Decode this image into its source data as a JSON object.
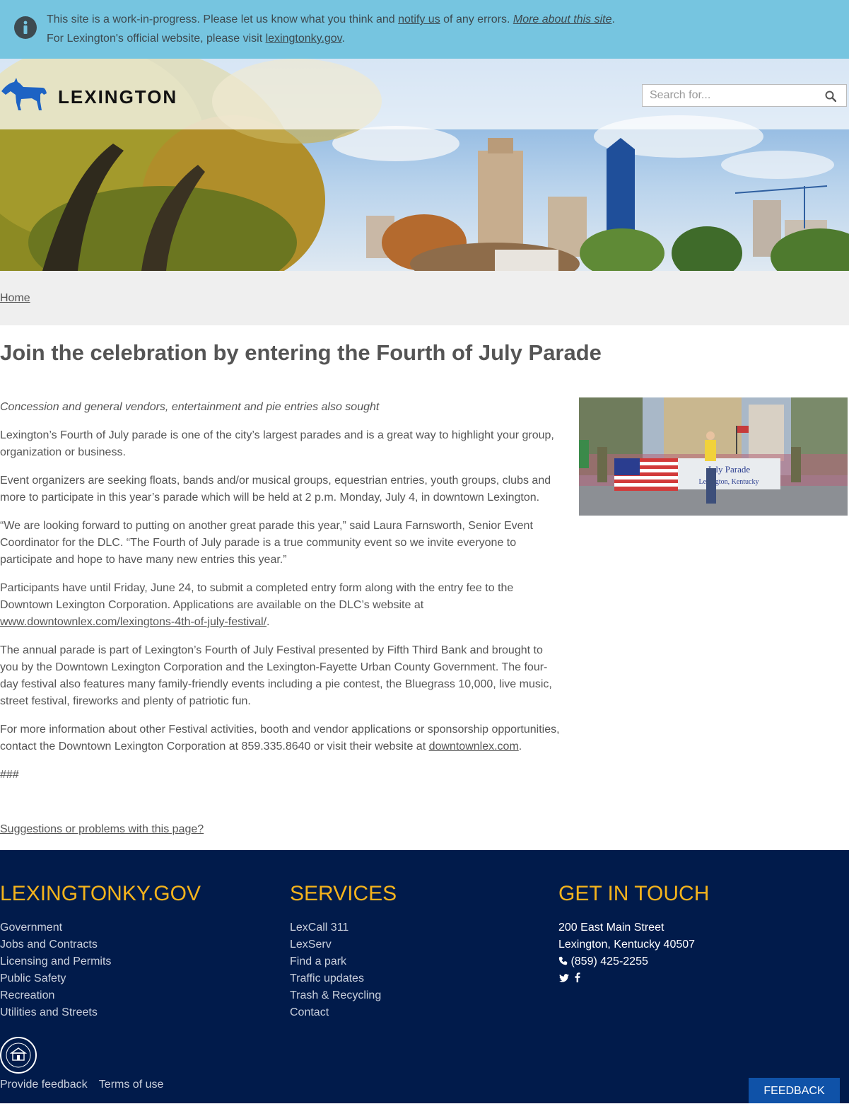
{
  "notice": {
    "text_1": "This site is a work-in-progress. Please let us know what you think and ",
    "link_notify": "notify us",
    "text_2": " of any errors. ",
    "link_more": "More about this site",
    "text_3": ".",
    "line2_text": "For Lexington's official website, please visit ",
    "link_official": "lexingtonky.gov",
    "line2_end": "."
  },
  "header": {
    "logo_text": "LEXINGTON",
    "search_placeholder": "Search for..."
  },
  "breadcrumb": {
    "home": "Home"
  },
  "article": {
    "title": "Join the celebration by entering the Fourth of July Parade",
    "lede": "Concession and general vendors, entertainment and pie entries also sought",
    "p1": "Lexington’s Fourth of July parade is one of the city’s largest parades and is a great way to highlight your group, organization or business.",
    "p2": "Event organizers are seeking floats, bands and/or musical groups, equestrian entries, youth groups, clubs and more to participate in this year’s parade which will be held at 2 p.m. Monday, July 4, in downtown Lexington.",
    "p3": "“We are looking forward to putting on another great parade this year,” said Laura Farnsworth, Senior Event Coordinator for the DLC. “The Fourth of July parade is a true community event so we invite everyone to participate and hope to have many new entries this year.”",
    "p4_text": "Participants have until Friday, June 24, to submit a completed entry form along with the entry fee to the Downtown Lexington Corporation. Applications are available on the DLC’s website at ",
    "p4_link": "www.downtownlex.com/lexingtons-4th-of-july-festival/",
    "p4_end": ".",
    "p5": "The annual parade is part of Lexington’s Fourth of July Festival presented by Fifth Third Bank and brought to you by the Downtown Lexington Corporation and the Lexington-Fayette Urban County Government. The four-day festival also features many family-friendly events including a pie contest, the Bluegrass 10,000, live music, street festival, fireworks and plenty of patriotic fun.",
    "p6_text": "For more information about other Festival activities, booth and vendor applications or sponsorship opportunities, contact the Downtown Lexington Corporation at 859.335.8640 or visit their website at ",
    "p6_link": "downtownlex.com",
    "p6_end": ".",
    "end_mark": "###",
    "banner_text": "July Parade",
    "banner_sub": "Lexington, Kentucky"
  },
  "suggestions_link": "Suggestions or problems with this page?",
  "footer": {
    "col1_title": "LEXINGTONKY.GOV",
    "col1_links": [
      "Government",
      "Jobs and Contracts",
      "Licensing and Permits",
      "Public Safety",
      "Recreation",
      "Utilities and Streets"
    ],
    "col2_title": "SERVICES",
    "col2_links": [
      "LexCall 311",
      "LexServ",
      "Find a park",
      "Traffic updates",
      "Trash & Recycling",
      "Contact"
    ],
    "col3_title": "GET IN TOUCH",
    "address_1": "200 East Main Street",
    "address_2": "Lexington, Kentucky 40507",
    "phone": "(859) 425-2255",
    "provide_feedback": "Provide feedback",
    "terms": "Terms of use",
    "feedback_button": "FEEDBACK"
  },
  "colors": {
    "notice_bg": "#76c5e0",
    "footer_bg": "#011b4b",
    "footer_heading": "#f4b31c",
    "feedback_btn": "#0f52a8",
    "horse": "#1d63c4"
  }
}
